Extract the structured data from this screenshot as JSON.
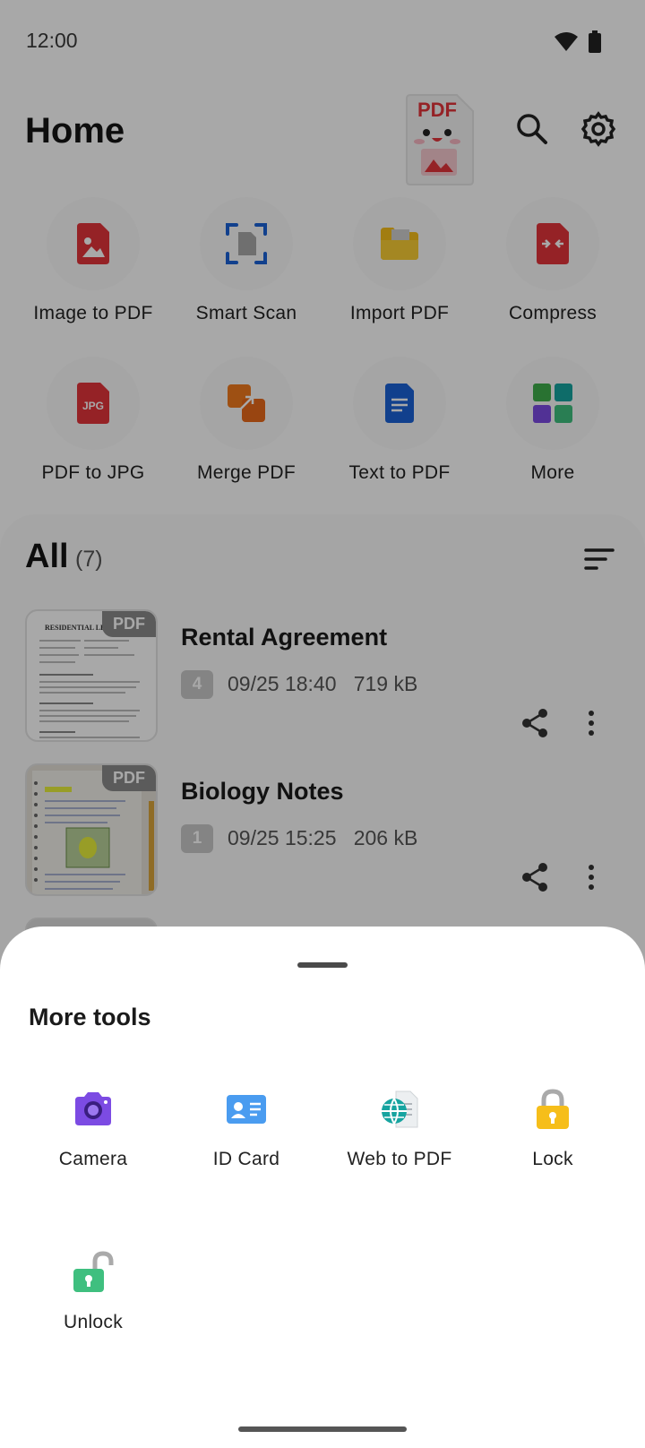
{
  "status_bar": {
    "time": "12:00"
  },
  "header": {
    "title": "Home"
  },
  "tools": [
    {
      "label": "Image to PDF",
      "icon": "image-pdf-icon"
    },
    {
      "label": "Smart Scan",
      "icon": "scan-icon"
    },
    {
      "label": "Import PDF",
      "icon": "folder-icon"
    },
    {
      "label": "Compress",
      "icon": "compress-icon"
    },
    {
      "label": "PDF to JPG",
      "icon": "jpg-icon"
    },
    {
      "label": "Merge PDF",
      "icon": "merge-icon"
    },
    {
      "label": "Text to PDF",
      "icon": "text-doc-icon"
    },
    {
      "label": "More",
      "icon": "grid-icon"
    }
  ],
  "all_section": {
    "title": "All",
    "count": "(7)"
  },
  "documents": [
    {
      "title": "Rental Agreement",
      "pages": "4",
      "date": "09/25 18:40",
      "size": "719 kB",
      "badge": "PDF",
      "thumb_heading": "RESIDENTIAL LEASE"
    },
    {
      "title": "Biology Notes",
      "pages": "1",
      "date": "09/25 15:25",
      "size": "206 kB",
      "badge": "PDF"
    }
  ],
  "more_tools_sheet": {
    "title": "More tools",
    "items": [
      {
        "label": "Camera",
        "icon": "camera-icon"
      },
      {
        "label": "ID Card",
        "icon": "id-card-icon"
      },
      {
        "label": "Web to PDF",
        "icon": "globe-doc-icon"
      },
      {
        "label": "Lock",
        "icon": "lock-icon"
      },
      {
        "label": "Unlock",
        "icon": "unlock-icon"
      }
    ]
  },
  "colors": {
    "red": "#e3343b",
    "blue": "#1b61d6",
    "yellow": "#f6be1a",
    "orange": "#f07a1e",
    "purple": "#7c4be3",
    "green": "#3fbf7f"
  }
}
